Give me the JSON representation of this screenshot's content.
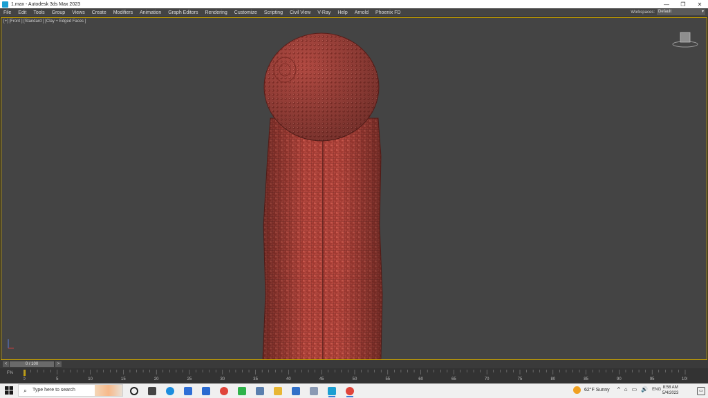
{
  "window": {
    "title": "1.max - Autodesk 3ds Max 2023",
    "controls": [
      "—",
      "❐",
      "✕"
    ]
  },
  "menu": {
    "items": [
      "File",
      "Edit",
      "Tools",
      "Group",
      "Views",
      "Create",
      "Modifiers",
      "Animation",
      "Graph Editors",
      "Rendering",
      "Customize",
      "Scripting",
      "Civil View",
      "V-Ray",
      "Help",
      "Arnold",
      "Phoenix FD"
    ],
    "workspaces_label": "Workspaces:",
    "workspace_value": "Default"
  },
  "viewport": {
    "label": "[+] [Front ] [Standard ] [Clay + Edged Faces ]",
    "filter_icon": "funnel-icon",
    "object_color": "#b5483f",
    "border_color": "#c8a200"
  },
  "time_slider": {
    "prev": "<",
    "frame_text": "0 / 100",
    "next": ">"
  },
  "track_bar": {
    "icon_text": "F%",
    "ticks": [
      "0",
      "5",
      "10",
      "15",
      "20",
      "25",
      "30",
      "35",
      "40",
      "45",
      "50",
      "55",
      "60",
      "65",
      "70",
      "75",
      "80",
      "85",
      "90",
      "95",
      "100"
    ]
  },
  "taskbar": {
    "search_placeholder": "Type here to search",
    "apps": [
      {
        "name": "cortana-icon",
        "color": "#222222"
      },
      {
        "name": "task-view-icon",
        "color": "#444444"
      },
      {
        "name": "edge-icon",
        "color": "#1b8dde"
      },
      {
        "name": "store-icon",
        "color": "#2f6fd6"
      },
      {
        "name": "mail-icon",
        "color": "#2a6ad0"
      },
      {
        "name": "chrome-icon",
        "color": "#e0443a"
      },
      {
        "name": "camtasia-icon",
        "color": "#2fb24a"
      },
      {
        "name": "app-icon-1",
        "color": "#5a7fae"
      },
      {
        "name": "file-explorer-icon",
        "color": "#e8b634"
      },
      {
        "name": "photos-icon",
        "color": "#3170c8"
      },
      {
        "name": "app-icon-2",
        "color": "#8a9ab4"
      },
      {
        "name": "3dsmax-icon",
        "color": "#1c9fd2"
      },
      {
        "name": "chrome-icon-2",
        "color": "#e0443a"
      }
    ],
    "weather": "62°F  Sunny",
    "tray_icons": [
      "^",
      "⌂",
      "▭",
      "🔊",
      "ENG"
    ],
    "time": "8:58 AM",
    "date": "5/4/2023"
  }
}
